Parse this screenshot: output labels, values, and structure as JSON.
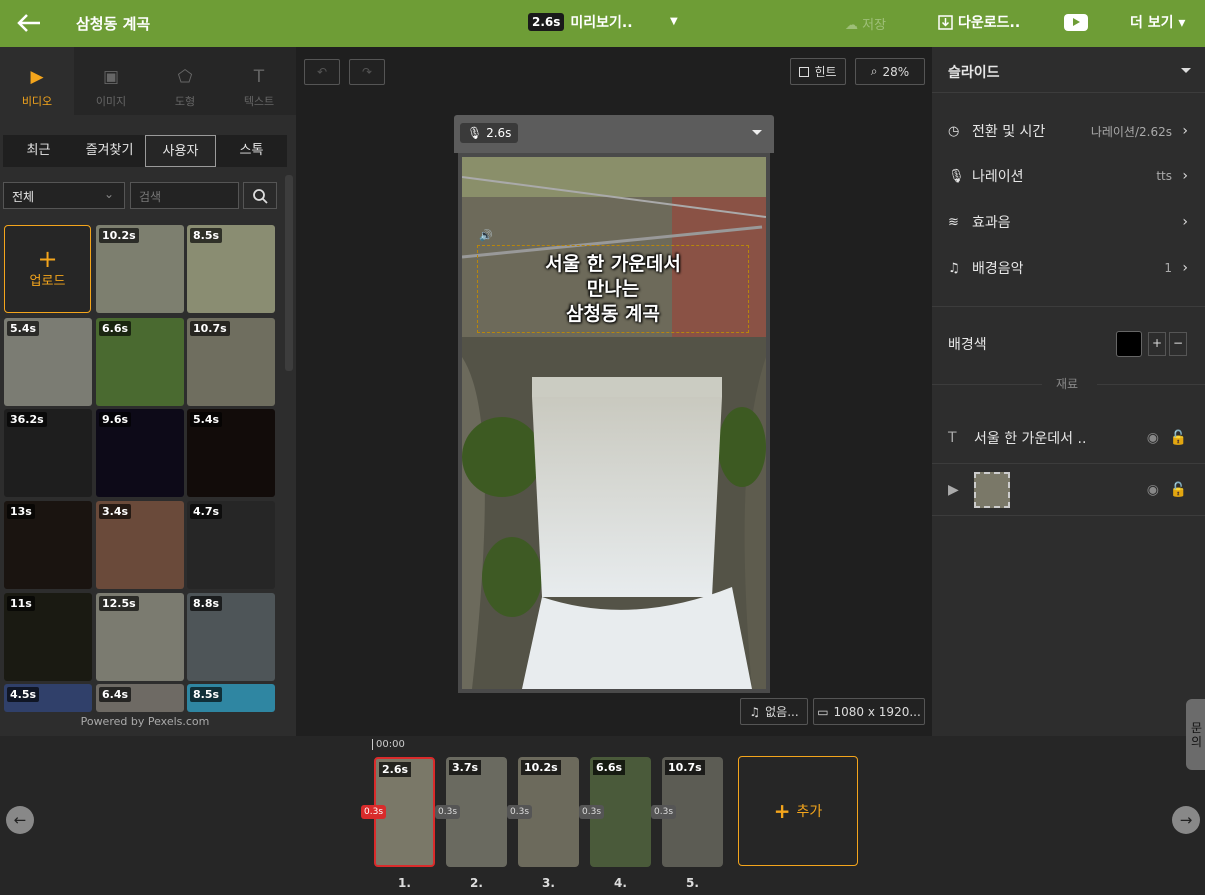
{
  "topbar": {
    "title": "삼청동 계곡",
    "preview_duration": "2.6s",
    "preview_label": "미리보기..",
    "save": "저장",
    "download": "다운로드..",
    "more": "더 보기"
  },
  "left": {
    "categories": [
      {
        "label": "비디오",
        "icon": "play-icon"
      },
      {
        "label": "이미지",
        "icon": "image-icon"
      },
      {
        "label": "도형",
        "icon": "pentagon-icon"
      },
      {
        "label": "텍스트",
        "icon": "text-icon"
      }
    ],
    "subtabs": [
      "최근",
      "즐겨찾기",
      "사용자",
      "스톡"
    ],
    "filter": "전체",
    "search_placeholder": "검색",
    "upload": "업로드",
    "thumbs": [
      "10.2s",
      "8.5s",
      "5.4s",
      "6.6s",
      "10.7s",
      "36.2s",
      "9.6s",
      "5.4s",
      "13s",
      "3.4s",
      "4.7s",
      "11s",
      "12.5s",
      "8.8s",
      "4.5s",
      "6.4s",
      "8.5s"
    ],
    "pexels": "Powered by Pexels.com"
  },
  "canvas": {
    "hint": "힌트",
    "zoom": "28%",
    "slide_duration": "2.6s",
    "caption": [
      "서울 한 가운데서",
      "만나는",
      "삼청동 계곡"
    ],
    "audio": "없음...",
    "resolution": "1080 x 1920..."
  },
  "right": {
    "header": "슬라이드",
    "rows": [
      {
        "label": "전환 및 시간",
        "value": "나레이션/2.62s"
      },
      {
        "label": "나레이션",
        "value": "tts"
      },
      {
        "label": "효과음",
        "value": ""
      },
      {
        "label": "배경음악",
        "value": "1"
      }
    ],
    "bg_label": "배경색",
    "bg_color": "#000000",
    "materials": "재료",
    "layer_text": "서울 한 가운데서 .."
  },
  "timeline": {
    "start": "00:00",
    "clips": [
      {
        "dur": "2.6s",
        "num": "1."
      },
      {
        "dur": "3.7s",
        "num": "2."
      },
      {
        "dur": "10.2s",
        "num": "3."
      },
      {
        "dur": "6.6s",
        "num": "4."
      },
      {
        "dur": "10.7s",
        "num": "5."
      }
    ],
    "transitions": [
      "0.3s",
      "0.3s",
      "0.3s",
      "0.3s",
      "0.3s"
    ],
    "add": "추가"
  },
  "help": "문의"
}
